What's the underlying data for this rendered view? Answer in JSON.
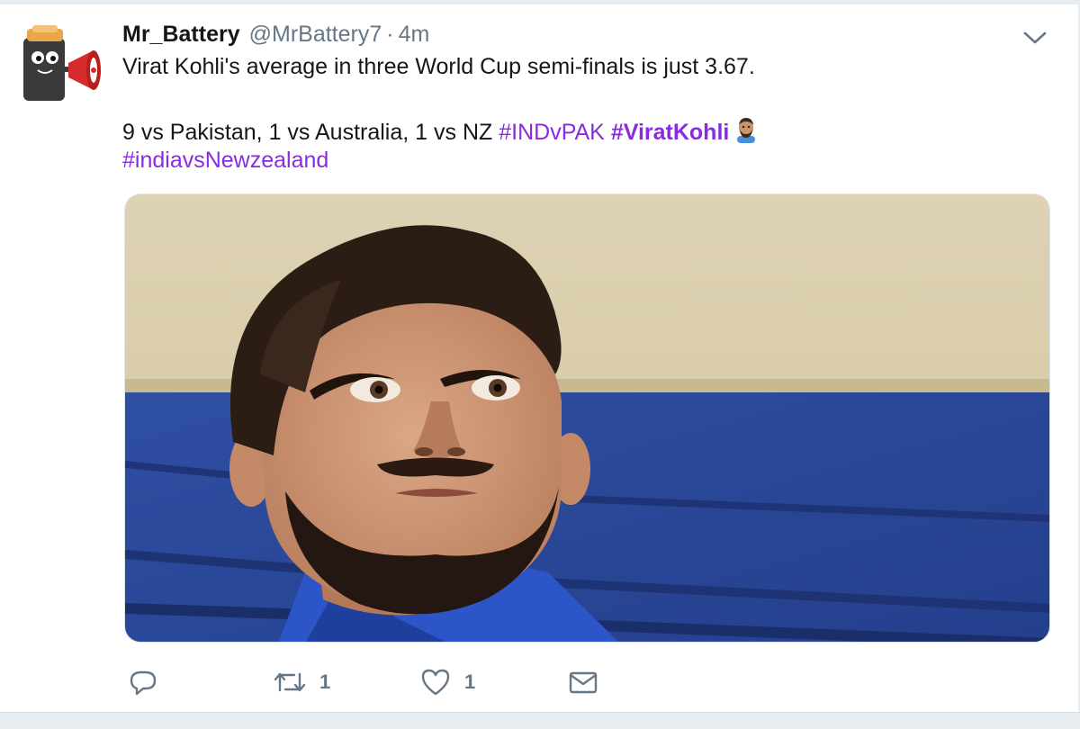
{
  "tweet": {
    "author_name": "Mr_Battery",
    "handle": "@MrBattery7",
    "separator": "·",
    "time": "4m",
    "text_line1": "Virat Kohli's average in three World Cup semi-finals is just 3.67.",
    "text_line2_plain": "9 vs Pakistan, 1 vs Australia, 1 vs NZ",
    "hashtags": [
      "#INDvPAK",
      "#ViratKohli",
      "#indiavsNewzealand"
    ]
  },
  "actions": {
    "reply_count": "",
    "retweet_count": "1",
    "like_count": "1"
  },
  "icons": {
    "avatar": "battery-mascot-with-megaphone",
    "caret": "chevron-down-icon",
    "reply": "reply-icon",
    "retweet": "retweet-icon",
    "like": "heart-icon",
    "dm": "envelope-icon",
    "emoji": "man-face-emoji"
  },
  "colors": {
    "hashtag": "#8a2be2",
    "text": "#14171a",
    "muted": "#657786"
  }
}
